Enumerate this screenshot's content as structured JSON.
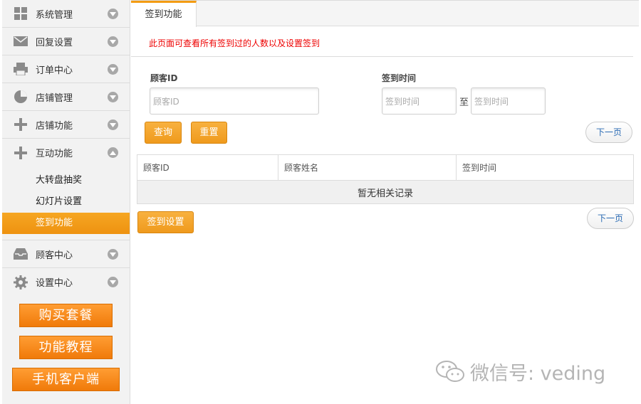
{
  "sidebar": {
    "items": [
      {
        "label": "系统管理",
        "icon": "grid-icon"
      },
      {
        "label": "回复设置",
        "icon": "envelope-icon"
      },
      {
        "label": "订单中心",
        "icon": "printer-icon"
      },
      {
        "label": "店铺管理",
        "icon": "pie-chart-icon"
      },
      {
        "label": "店铺功能",
        "icon": "plus-icon"
      },
      {
        "label": "互动功能",
        "icon": "plus-icon"
      }
    ],
    "submenu": [
      "大转盘抽奖",
      "幻灯片设置",
      "签到功能"
    ],
    "bottom_items": [
      {
        "label": "顾客中心",
        "icon": "inbox-icon"
      },
      {
        "label": "设置中心",
        "icon": "gear-icon"
      }
    ],
    "promos": [
      "购买套餐",
      "功能教程",
      "手机客户端"
    ]
  },
  "main": {
    "tab": "签到功能",
    "notice": "此页面可查看所有签到过的人数以及设置签到",
    "filters": {
      "customer_id_label": "顾客ID",
      "customer_id_placeholder": "顾客ID",
      "signin_time_label": "签到时间",
      "from_placeholder": "签到时间",
      "to_text": "至",
      "to_placeholder": "签到时间"
    },
    "query_button": "查询",
    "reset_button": "重置",
    "next_page": "下一页",
    "table": {
      "headers": [
        "顾客ID",
        "顾客姓名",
        "签到时间"
      ],
      "empty_text": "暂无相关记录"
    },
    "settings_button": "签到设置",
    "next_page_bottom": "下一页"
  },
  "watermark": "微信号: veding",
  "colors": {
    "accent": "#f39c12",
    "notice": "#e00000",
    "link": "#2a6ab3"
  }
}
